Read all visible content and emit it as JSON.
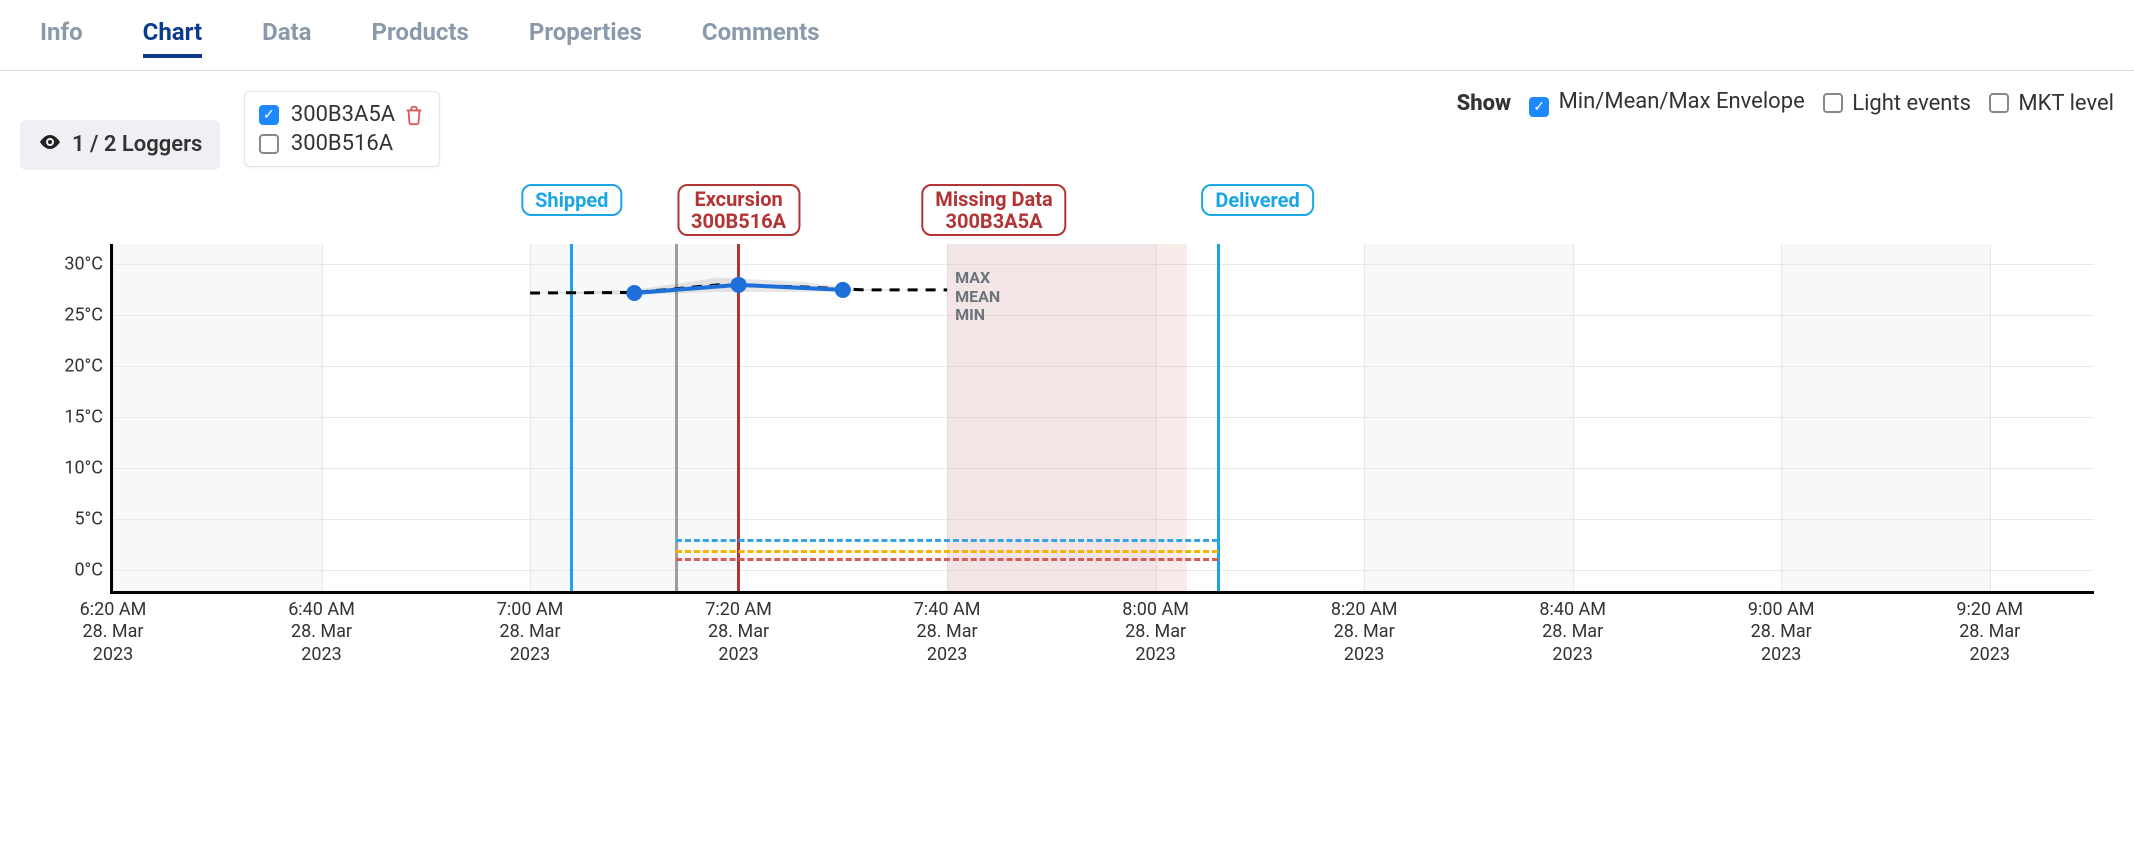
{
  "tabs": [
    "Info",
    "Chart",
    "Data",
    "Products",
    "Properties",
    "Comments"
  ],
  "active_tab": "Chart",
  "loggers_summary": "1 / 2 Loggers",
  "loggers": [
    {
      "id": "300B3A5A",
      "checked": true,
      "trash": true
    },
    {
      "id": "300B516A",
      "checked": false,
      "trash": false
    }
  ],
  "show_label": "Show",
  "show_options": {
    "envelope": {
      "label": "Min/Mean/Max Envelope",
      "checked": true
    },
    "light": {
      "label": "Light events",
      "checked": false
    },
    "mkt": {
      "label": "MKT level",
      "checked": false
    }
  },
  "events": {
    "shipped": {
      "label": "Shipped",
      "color": "#1aa6e5",
      "time_min": 44
    },
    "gray": {
      "color": "#9e9e9e",
      "time_min": 54
    },
    "excursion": {
      "label1": "Excursion",
      "label2": "300B516A",
      "color": "#b33434",
      "time_min": 60
    },
    "delivered": {
      "label": "Delivered",
      "color": "#1aa6e5",
      "time_min": 106
    }
  },
  "missing": {
    "label1": "Missing Data",
    "label2": "300B3A5A",
    "color": "#b33434",
    "from_min": 80,
    "to_min": 103
  },
  "env_labels": [
    "MAX",
    "MEAN",
    "MIN"
  ],
  "limit_lines": [
    {
      "y": 3,
      "color": "#36a3e5"
    },
    {
      "y": 2,
      "color": "#f4b400"
    },
    {
      "y": 1.2,
      "color": "#d85a5a"
    }
  ],
  "chart_data": {
    "type": "line",
    "title": "",
    "xlabel": "",
    "ylabel": "",
    "y_axis": {
      "min": -2,
      "max": 32,
      "ticks": [
        0,
        5,
        10,
        15,
        20,
        25,
        30
      ],
      "unit": "°C"
    },
    "x_axis": {
      "start": "2023-03-28T06:20:00",
      "end": "2023-03-28T09:30:00",
      "ticks": [
        {
          "time": "6:20 AM",
          "date": "28. Mar",
          "year": "2023"
        },
        {
          "time": "6:40 AM",
          "date": "28. Mar",
          "year": "2023"
        },
        {
          "time": "7:00 AM",
          "date": "28. Mar",
          "year": "2023"
        },
        {
          "time": "7:20 AM",
          "date": "28. Mar",
          "year": "2023"
        },
        {
          "time": "7:40 AM",
          "date": "28. Mar",
          "year": "2023"
        },
        {
          "time": "8:00 AM",
          "date": "28. Mar",
          "year": "2023"
        },
        {
          "time": "8:20 AM",
          "date": "28. Mar",
          "year": "2023"
        },
        {
          "time": "8:40 AM",
          "date": "28. Mar",
          "year": "2023"
        },
        {
          "time": "9:00 AM",
          "date": "28. Mar",
          "year": "2023"
        },
        {
          "time": "9:20 AM",
          "date": "28. Mar",
          "year": "2023"
        }
      ]
    },
    "series": [
      {
        "name": "300B3A5A MEAN",
        "color": "#1e6fd8",
        "points": [
          {
            "x_min": 50,
            "y": 27.2
          },
          {
            "x_min": 60,
            "y": 28.0
          },
          {
            "x_min": 70,
            "y": 27.5
          }
        ]
      }
    ],
    "envelope": [
      {
        "x_min": 40,
        "min": 27.2,
        "max": 27.2
      },
      {
        "x_min": 50,
        "min": 27.0,
        "max": 27.5
      },
      {
        "x_min": 58,
        "min": 27.3,
        "max": 28.7
      },
      {
        "x_min": 66,
        "min": 27.3,
        "max": 28.3
      },
      {
        "x_min": 72,
        "min": 27.4,
        "max": 27.6
      },
      {
        "x_min": 80,
        "min": 27.5,
        "max": 27.5
      }
    ],
    "annotations": {
      "plot_lines": [
        {
          "label": "Shipped",
          "x_min": 44,
          "color": "#1aa6e5"
        },
        {
          "label": "",
          "x_min": 54,
          "color": "#9e9e9e"
        },
        {
          "label": "Excursion 300B516A",
          "x_min": 60,
          "color": "#b33434"
        },
        {
          "label": "Delivered",
          "x_min": 106,
          "color": "#1aa6e5"
        }
      ],
      "plot_bands": [
        {
          "label": "Missing Data 300B3A5A",
          "from_min": 80,
          "to_min": 103,
          "color": "rgba(216,90,90,0.12)"
        }
      ],
      "threshold_lines": [
        {
          "y": 3,
          "color": "#36a3e5",
          "from_min": 54,
          "to_min": 106
        },
        {
          "y": 2,
          "color": "#f4b400",
          "from_min": 54,
          "to_min": 106
        },
        {
          "y": 1.2,
          "color": "#d85a5a",
          "from_min": 54,
          "to_min": 106
        }
      ]
    }
  }
}
